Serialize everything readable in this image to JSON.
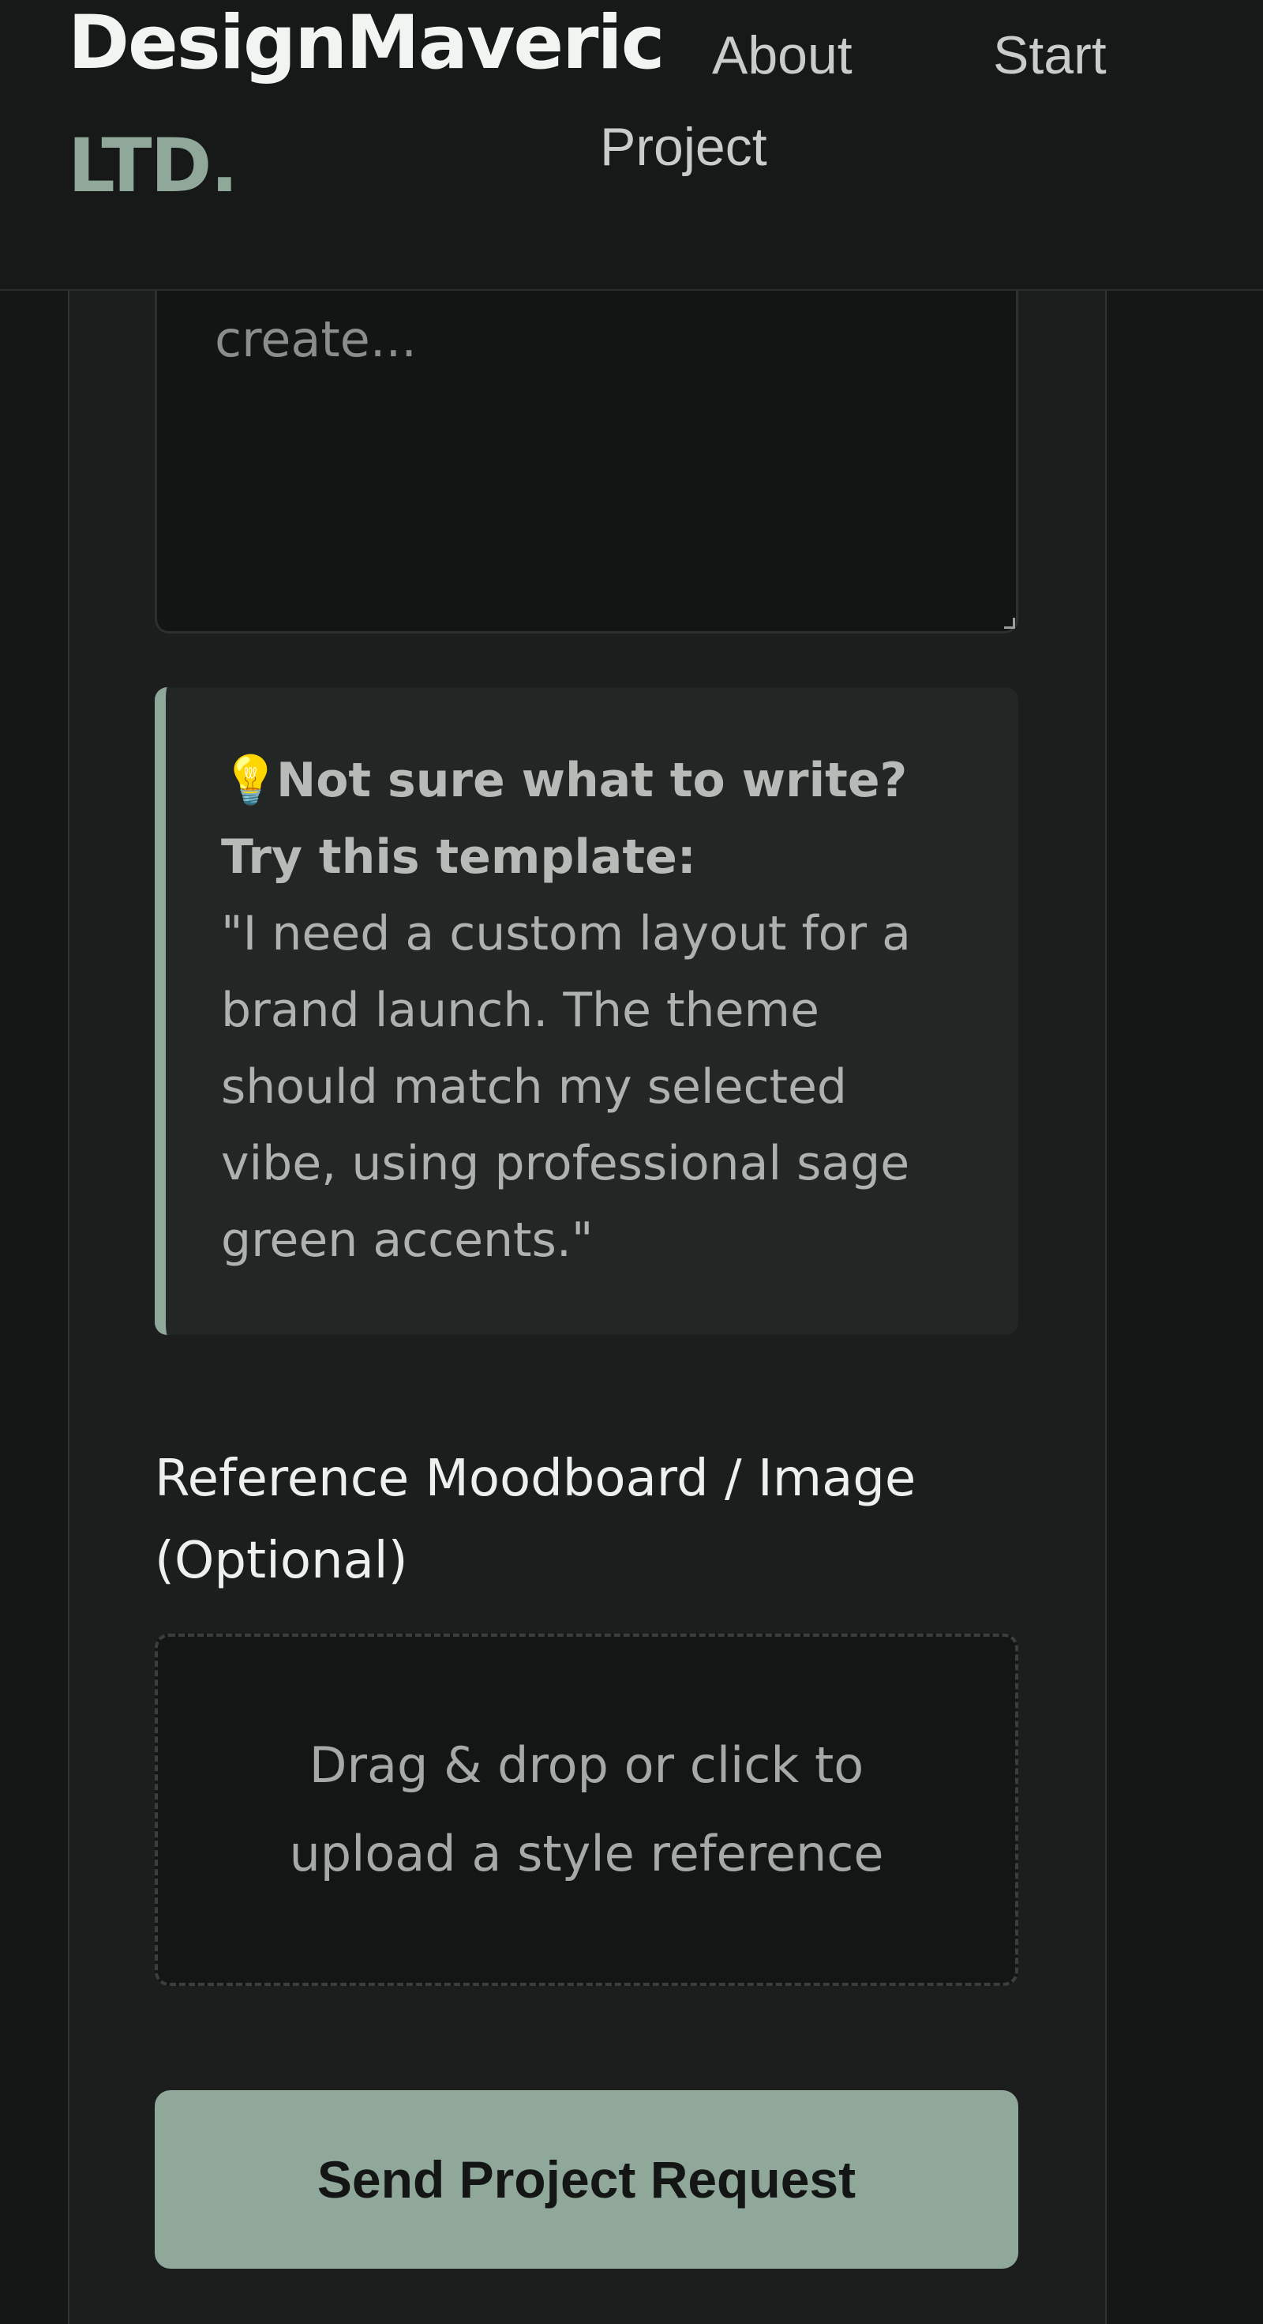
{
  "header": {
    "brand_name": "DesignMaveric",
    "brand_suffix": "LTD.",
    "nav": {
      "about": "About",
      "start_project_line1": "Start",
      "start_project_line2": "Project"
    }
  },
  "form": {
    "description_placeholder_visible": "create...",
    "tip": {
      "icon": "lightbulb-icon",
      "heading": "Not sure what to write? Try this template:",
      "template": "\"I need a custom layout for a brand launch. The theme should match my selected vibe, using professional sage green accents.\""
    },
    "upload": {
      "label": "Reference Moodboard / Image (Optional)",
      "dropzone_text": "Drag & drop or click to upload a style reference"
    },
    "submit_label": "Send Project Request"
  },
  "colors": {
    "accent": "#8fa89a",
    "background": "#151716",
    "panel": "#1c1e1d"
  }
}
